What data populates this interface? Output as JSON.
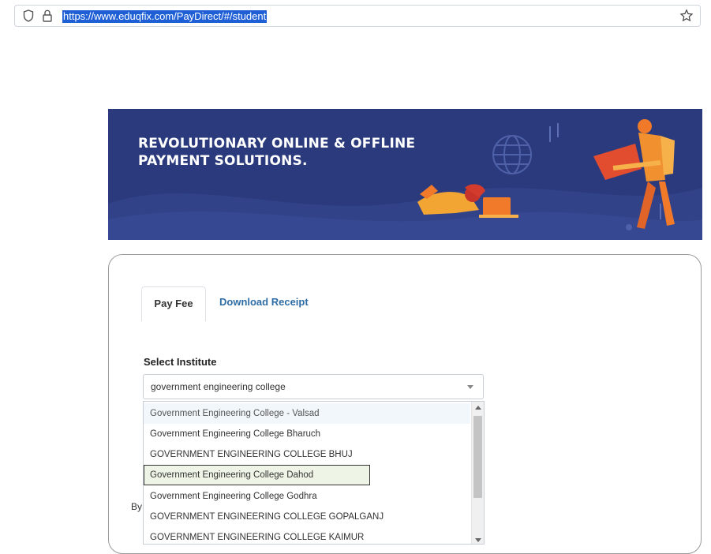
{
  "browser": {
    "url": "https://www.eduqfix.com/PayDirect/#/student",
    "icons": [
      "shield-icon",
      "lock-icon",
      "bookmark-star-icon"
    ]
  },
  "banner": {
    "headline_line1": "REVOLUTIONARY ONLINE & OFFLINE",
    "headline_line2": "PAYMENT SOLUTIONS.",
    "colors": {
      "background": "#2a3a7c",
      "accent": "#f07a2a"
    }
  },
  "tabs": [
    {
      "label": "Pay Fee",
      "active": true
    },
    {
      "label": "Download Receipt",
      "active": false
    }
  ],
  "form": {
    "institute_label": "Select Institute",
    "institute_value": "government engineering college",
    "footer_fragment": "By"
  },
  "dropdown": {
    "options": [
      "Government Engineering College - Valsad",
      "Government Engineering College Bharuch",
      "GOVERNMENT ENGINEERING COLLEGE BHUJ",
      "Government Engineering College Dahod",
      "Government Engineering College Godhra",
      "GOVERNMENT ENGINEERING COLLEGE GOPALGANJ",
      "GOVERNMENT ENGINEERING COLLEGE KAIMUR"
    ],
    "highlighted_option": "Government Engineering College Dahod"
  }
}
